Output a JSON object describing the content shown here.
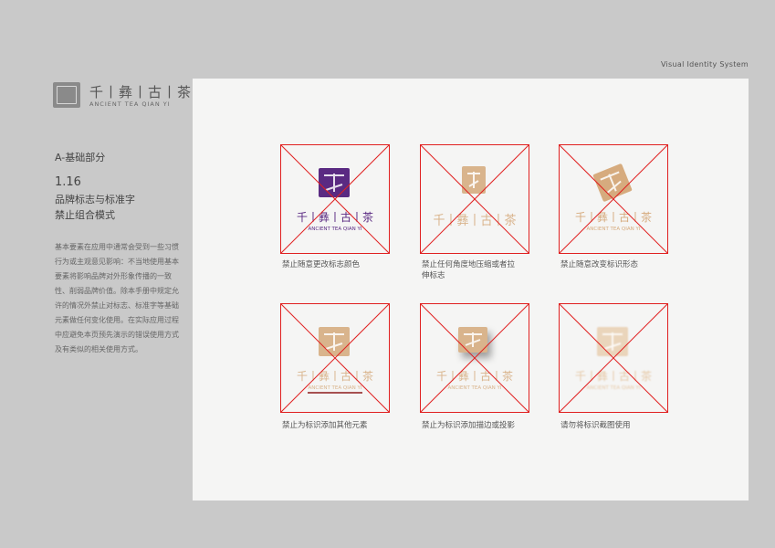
{
  "header": {
    "system_label": "Visual Identity System"
  },
  "brand": {
    "name": "千丨彝丨古丨茶",
    "latin": "ANCIENT TEA QIAN YI"
  },
  "section": {
    "tag": "A-基础部分",
    "number": "1.16",
    "title_line1": "品牌标志与标准字",
    "title_line2": "禁止组合模式",
    "description": "基本要素在应用中通常会受到一些习惯行为或主观意见影响：不当地使用基本要素将影响品牌对外形象传播的一致性、削弱品牌价值。除本手册中规定允许的情况外禁止对标志、标准字等基础元素做任何变化使用。在实际应用过程中应避免本页预先演示的错误使用方式及有类似的相关使用方式。"
  },
  "examples": [
    {
      "caption": "禁止随意更改标志颜色",
      "logo_color": "#5a2a82"
    },
    {
      "caption": "禁止任何角度地压缩或者拉伸标志",
      "logo_color": "#d9b48c"
    },
    {
      "caption": "禁止随意改变标识形态",
      "logo_color": "#d6ab7e"
    },
    {
      "caption": "禁止为标识添加其他元素",
      "logo_color": "#d9b48c"
    },
    {
      "caption": "禁止为标识添加描边或投影",
      "logo_color": "#d9b48c"
    },
    {
      "caption": "请勿将标识截图使用",
      "logo_color": "#e6c9a8"
    }
  ],
  "logo_text": {
    "name": "千丨彝丨古丨茶",
    "latin": "ANCIENT TEA QIAN YI"
  },
  "colors": {
    "cross": "#e02020",
    "background": "#c9c9c9",
    "panel": "#f5f5f4"
  }
}
